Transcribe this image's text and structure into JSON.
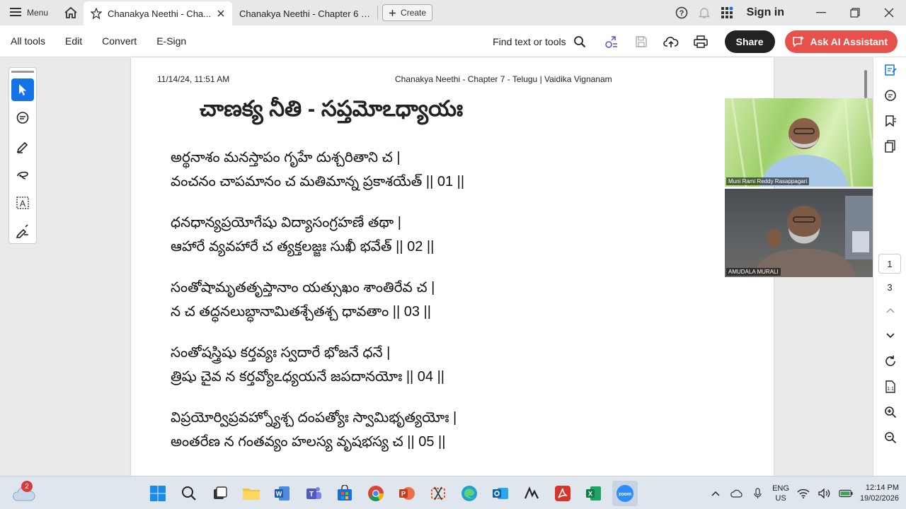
{
  "tabbar": {
    "menu_label": "Menu",
    "tabs": [
      {
        "title": "Chanakya Neethi - Cha..."
      },
      {
        "title": "Chanakya Neethi - Chapter 6 - ..."
      }
    ],
    "create_label": "Create",
    "sign_in_label": "Sign in"
  },
  "toolbar": {
    "menu": [
      "All tools",
      "Edit",
      "Convert",
      "E-Sign"
    ],
    "find_label": "Find text or tools",
    "share_label": "Share",
    "ai_label": "Ask AI Assistant"
  },
  "document": {
    "date": "11/14/24, 11:51 AM",
    "header": "Chanakya Neethi - Chapter 7 - Telugu | Vaidika Vignanam",
    "title": "చాణక్య నీతి - సప్తమోఽధ్యాయః",
    "verses": [
      {
        "line1": "అర్థనాశం మనస్తాపం గృహే దుశ్చరితాని చ |",
        "line2": "వంచనం చాపమానం చ మతిమాన్న ప్రకాశయేత్ || 01 ||"
      },
      {
        "line1": "ధనధాన్యప్రయోగేషు విద్యాసంగ్రహణే తథా |",
        "line2": "ఆహారే వ్యవహారే చ త్యక్తలజ్జః సుఖీ భవేత్ || 02 ||"
      },
      {
        "line1": "సంతోషామృతతృప్తానాం యత్సుఖం శాంతిరేవ చ |",
        "line2": "న చ తద్ధనలుబ్ధానామితశ్చేతశ్చ ధావతాం || 03 ||"
      },
      {
        "line1": "సంతోషస్త్రిషు కర్తవ్యః స్వదారే భోజనే ధనే |",
        "line2": "త్రిషు చైవ న కర్తవ్యోఽధ్యయనే జపదానయోః || 04 ||"
      },
      {
        "line1": "విప్రయోర్విప్రవహ్న్యోశ్చ దంపత్యోః స్వామిభృత్యయోః |",
        "line2": "అంతరేణ న గంతవ్యం హలస్య వృషభస్య చ || 05 ||"
      }
    ]
  },
  "video": {
    "participant1": "Muni Rami Reddy Rasappagari",
    "participant2": "AMUDALA MURALI"
  },
  "pagenav": {
    "current": "1",
    "total": "3"
  },
  "taskbar": {
    "badge": "2",
    "lang1": "ENG",
    "lang2": "US",
    "time": "12:14 PM",
    "date": "19/02/2026"
  },
  "colors": {
    "accent": "#1473e6",
    "ai_button": "#e8504b",
    "share_button": "#222222"
  }
}
